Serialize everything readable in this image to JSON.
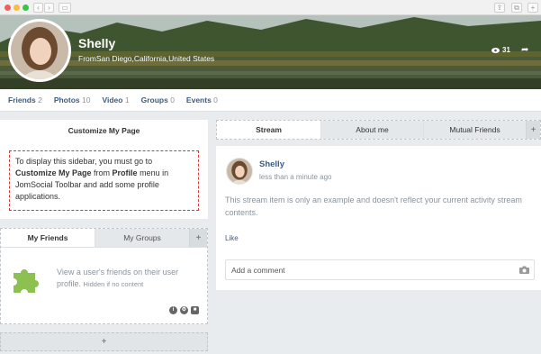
{
  "profile": {
    "name": "Shelly",
    "location": "FromSan Diego,California,United States",
    "views": "31"
  },
  "profile_tabs": [
    {
      "label": "Friends",
      "count": "2"
    },
    {
      "label": "Photos",
      "count": "10"
    },
    {
      "label": "Video",
      "count": "1"
    },
    {
      "label": "Groups",
      "count": "0"
    },
    {
      "label": "Events",
      "count": "0"
    }
  ],
  "customize": {
    "title": "Customize My Page",
    "text_1": "To display this sidebar, you must go to ",
    "bold_1": "Customize My Page",
    "text_2": " from ",
    "bold_2": "Profile",
    "text_3": " menu in JomSocial Toolbar and add some profile applications."
  },
  "friends_widget": {
    "tab_active": "My Friends",
    "tab_inactive": "My Groups",
    "add": "+",
    "message": "View a user's friends on their user profile.",
    "hidden_note": "Hidden if no content"
  },
  "add_bar": "+",
  "stream_tabs": {
    "tab_active": "Stream",
    "tab_2": "About me",
    "tab_3": "Mutual Friends",
    "add": "+"
  },
  "stream_item": {
    "author": "Shelly",
    "time": "less than a minute ago",
    "message": "This stream item is only an example and doesn't reflect your current activity stream contents.",
    "like": "Like",
    "comment_placeholder": "Add a comment"
  },
  "colors": {
    "link": "#3c5c83",
    "muted": "#8a949c",
    "dashed_red": "#dd3333"
  }
}
